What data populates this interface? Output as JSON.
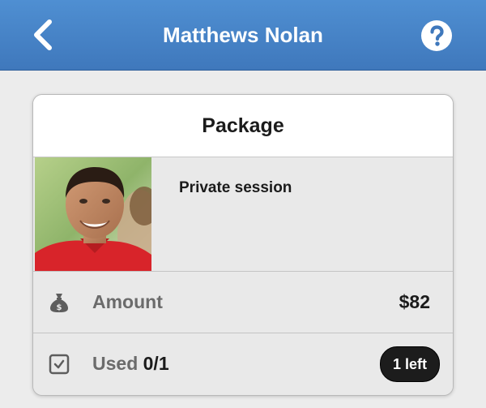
{
  "header": {
    "title": "Matthews Nolan",
    "back_icon": "chevron-left-icon",
    "help_icon": "question-circle-icon"
  },
  "card": {
    "title": "Package",
    "package": {
      "name": "Private session",
      "photo": "person-photo"
    },
    "amount": {
      "icon": "money-bag-icon",
      "label": "Amount",
      "value": "$82"
    },
    "used": {
      "icon": "checkbox-icon",
      "label": "Used",
      "value": "0/1",
      "badge": "1 left"
    }
  },
  "colors": {
    "header_bg": "#4682c6",
    "header_text": "#ffffff",
    "card_bg": "#e9e9e9",
    "badge_bg": "#1c1c1c"
  }
}
